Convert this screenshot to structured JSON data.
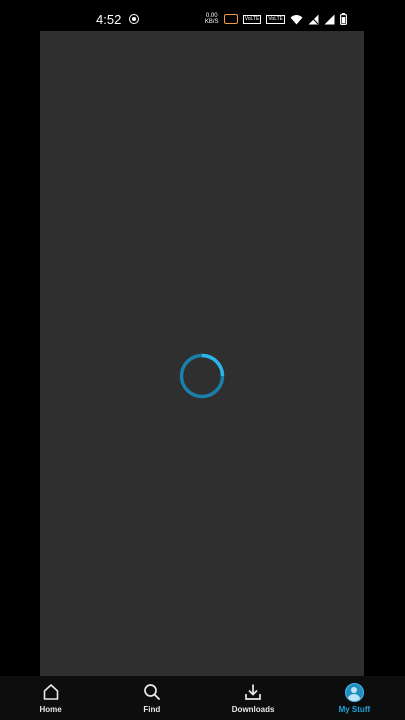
{
  "status_bar": {
    "time": "4:52",
    "network_speed_value": "0.00",
    "network_speed_unit": "KB/S",
    "volte_1": "VoLTE",
    "volte_2": "VoLTE"
  },
  "content": {
    "state": "loading",
    "spinner_color": "#1fa6d9"
  },
  "bottom_nav": {
    "items": [
      {
        "label": "Home",
        "icon": "home-icon"
      },
      {
        "label": "Find",
        "icon": "search-icon"
      },
      {
        "label": "Downloads",
        "icon": "download-icon"
      },
      {
        "label": "My Stuff",
        "icon": "profile-avatar-icon"
      }
    ],
    "active_color": "#1fa6d9"
  }
}
